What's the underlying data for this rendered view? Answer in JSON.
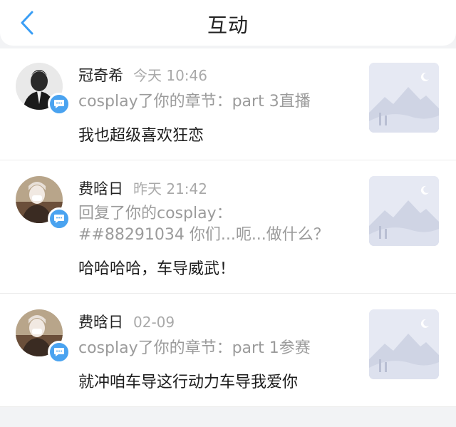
{
  "header": {
    "title": "互动"
  },
  "items": [
    {
      "name": "冠奇希",
      "time": "今天 10:46",
      "desc": "cosplay了你的章节：part 3直播",
      "content": "我也超级喜欢狂恋"
    },
    {
      "name": "费晗日",
      "time": "昨天 21:42",
      "desc_line1": "回复了你的cosplay：",
      "desc_line2": "##88291034 你们...呃...做什么？",
      "content": "哈哈哈哈，车导威武！"
    },
    {
      "name": "费晗日",
      "time": "02-09",
      "desc": "cosplay了你的章节：part 1参赛",
      "content": "就冲咱车导这行动力车导我爱你"
    }
  ],
  "colors": {
    "accent": "#4aa3f0",
    "background": "#f2f3f5"
  }
}
